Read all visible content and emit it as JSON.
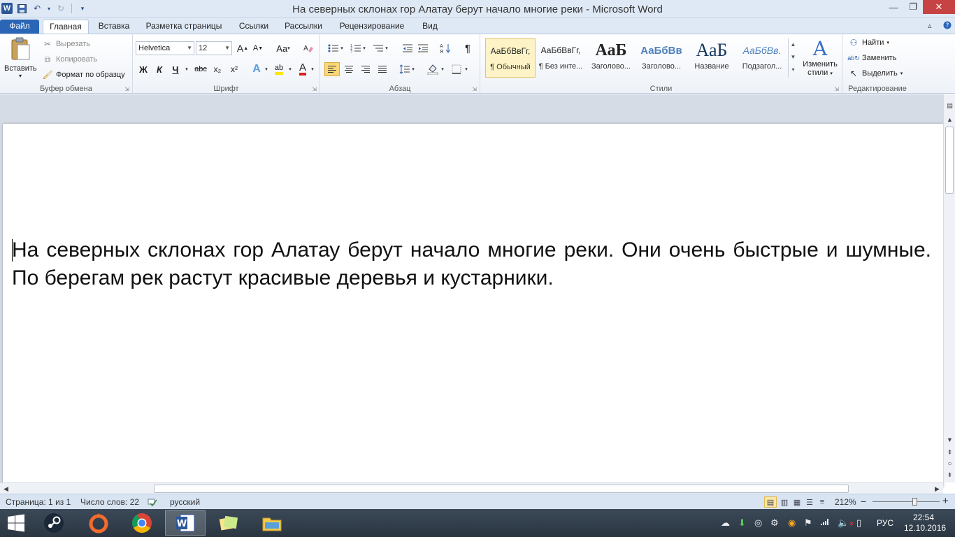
{
  "window": {
    "title": "На северных склонах гор Алатау берут начало многие реки  -  Microsoft Word",
    "app_icon_letter": "W",
    "min_icon": "—",
    "max_icon": "❐",
    "close_icon": "✕"
  },
  "tabs": {
    "file": "Файл",
    "items": [
      "Главная",
      "Вставка",
      "Разметка страницы",
      "Ссылки",
      "Рассылки",
      "Рецензирование",
      "Вид"
    ]
  },
  "clipboard": {
    "paste": "Вставить",
    "cut": "Вырезать",
    "copy": "Копировать",
    "format_painter": "Формат по образцу",
    "group_label": "Буфер обмена"
  },
  "font": {
    "name": "Helvetica",
    "size": "12",
    "grow": "A",
    "shrink": "A",
    "change_case": "Aa",
    "bold": "Ж",
    "italic": "К",
    "underline": "Ч",
    "strike": "abc",
    "subscript": "x₂",
    "superscript": "x²",
    "text_effects": "A",
    "highlight": "ab",
    "font_color": "A",
    "group_label": "Шрифт"
  },
  "paragraph": {
    "pilcrow": "¶",
    "group_label": "Абзац"
  },
  "styles": {
    "items": [
      {
        "sample": "АаБбВвГг,",
        "name": "¶ Обычный"
      },
      {
        "sample": "АаБбВвГг,",
        "name": "¶ Без инте..."
      },
      {
        "sample": "АаБ",
        "name": "Заголово..."
      },
      {
        "sample": "АаБбВв",
        "name": "Заголово..."
      },
      {
        "sample": "АаБ",
        "name": "Название"
      },
      {
        "sample": "АаБбВв.",
        "name": "Подзагол..."
      }
    ],
    "change_styles_line1": "Изменить",
    "change_styles_line2": "стили",
    "group_label": "Стили"
  },
  "editing": {
    "find": "Найти",
    "replace": "Заменить",
    "select": "Выделить",
    "group_label": "Редактирование"
  },
  "document": {
    "text": "На северных склонах гор Алатау берут начало многие реки. Они очень быстрые и шумные. По берегам рек растут красивые деревья и кустарники."
  },
  "status": {
    "page": "Страница: 1 из 1",
    "words": "Число слов: 22",
    "language": "русский",
    "zoom": "212%",
    "zoom_level_percent": 212,
    "zoom_minus": "−",
    "zoom_plus": "+"
  },
  "taskbar": {
    "lang": "РУС",
    "time": "22:54",
    "date": "12.10.2016"
  },
  "colors": {
    "file_tab": "#2a65b6",
    "word_blue": "#2b579a",
    "close_red": "#c74343",
    "font_color_red": "#e02020",
    "highlight_yellow": "#ffe600"
  }
}
